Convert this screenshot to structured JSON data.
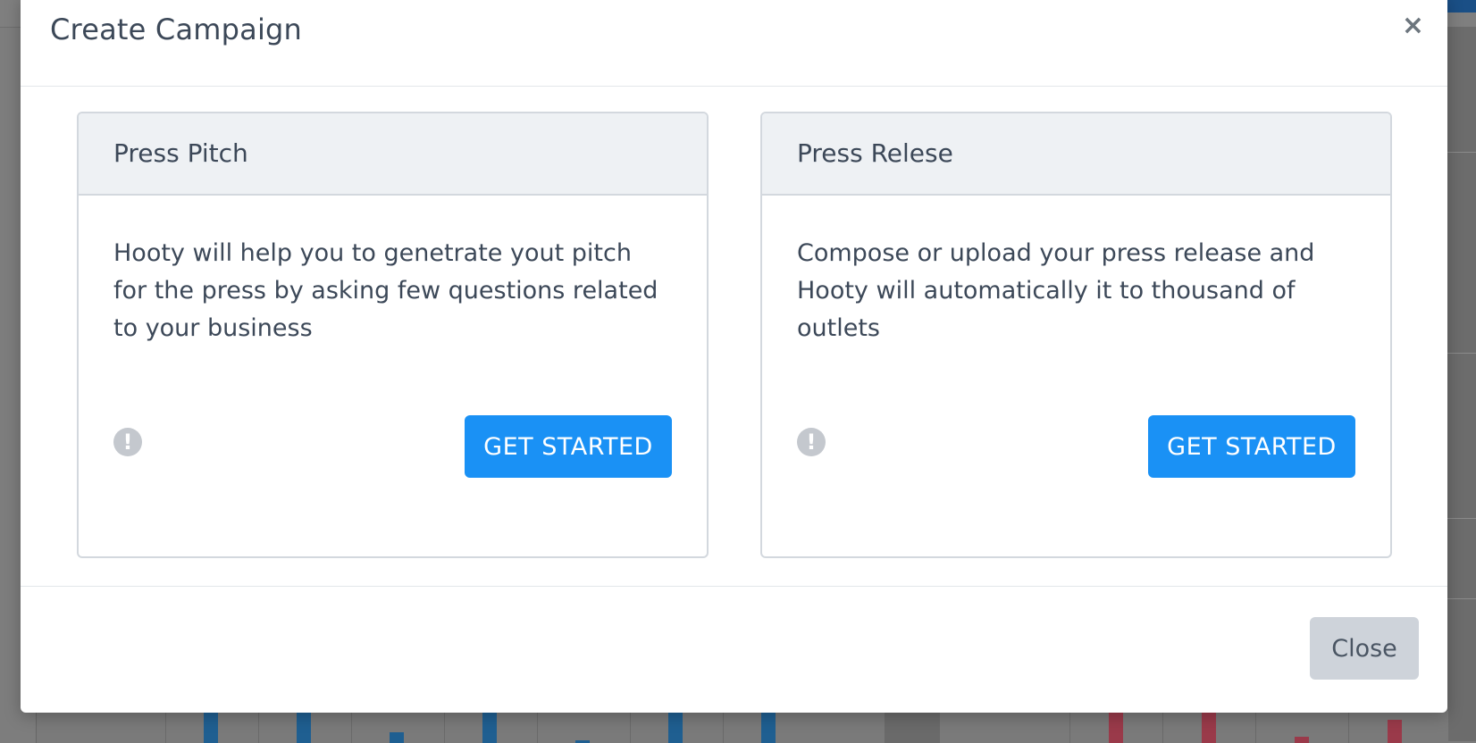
{
  "modal": {
    "title": "Create Campaign",
    "close_icon_glyph": "×",
    "close_button_label": "Close"
  },
  "cards": [
    {
      "title": "Press Pitch",
      "description": "Hooty will help you to genetrate yout pitch for the press by asking few questions related to your business",
      "info_icon": "exclamation-circle-icon",
      "button_label": "GET STARTED"
    },
    {
      "title": "Press Relese",
      "description": "Compose or upload your press release and Hooty will automatically it to thousand of outlets",
      "info_icon": "exclamation-circle-icon",
      "button_label": "GET STARTED"
    }
  ],
  "colors": {
    "primary": "#1a91f5",
    "secondary_button": "#ced3da",
    "card_header_bg": "#eef1f4",
    "text": "#3c4858",
    "backdrop": "#7d7d7d"
  }
}
